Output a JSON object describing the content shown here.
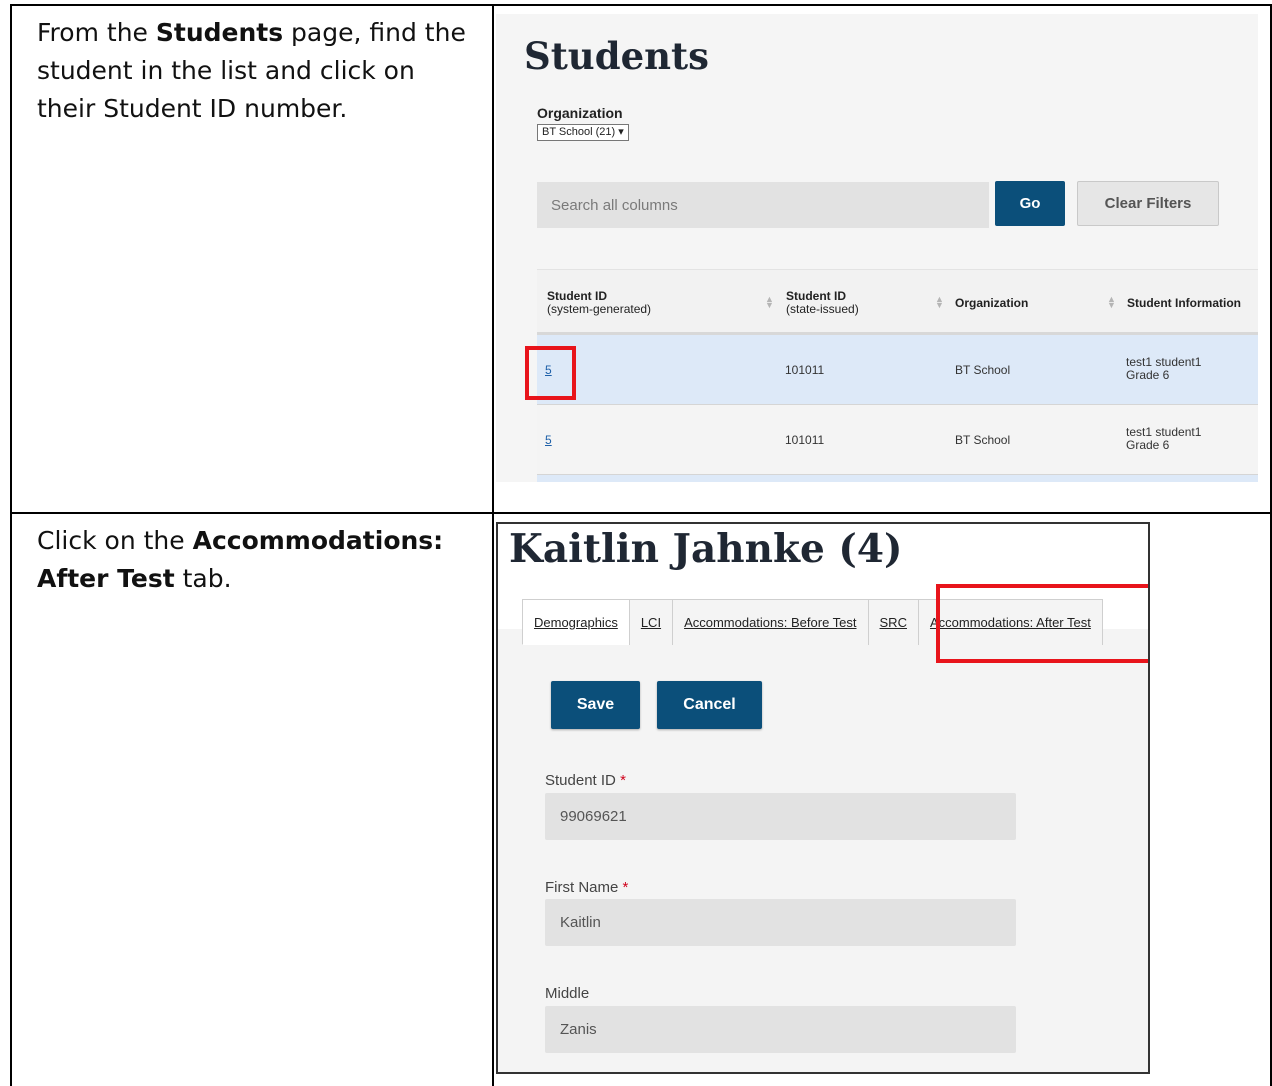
{
  "step1": {
    "instruction": {
      "before": "From the ",
      "bold": "Students",
      "after": " page, find the student in the list and click on their Student ID number."
    },
    "screen": {
      "title": "Students",
      "organization_label": "Organization",
      "organization_selected": "BT School (21) ▾",
      "search_placeholder": "Search all columns",
      "go_label": "Go",
      "clear_label": "Clear Filters",
      "columns": [
        {
          "title": "Student ID",
          "sub": "(system-generated)"
        },
        {
          "title": "Student ID",
          "sub": "(state-issued)"
        },
        {
          "title": "Organization",
          "sub": ""
        },
        {
          "title": "Student Information",
          "sub": ""
        }
      ],
      "rows": [
        {
          "id": "5",
          "state_id": "101011",
          "org": "BT School",
          "name": "test1 student1",
          "grade": "Grade 6"
        },
        {
          "id": "5",
          "state_id": "101011",
          "org": "BT School",
          "name": "test1 student1",
          "grade": "Grade 6"
        }
      ]
    }
  },
  "step2": {
    "instruction": {
      "before": "Click on the ",
      "bold": "Accommodations: After Test",
      "after": " tab."
    },
    "screen": {
      "title": "Kaitlin Jahnke (4)",
      "tabs": [
        "Demographics",
        "LCI",
        "Accommodations: Before Test",
        "SRC",
        "Accommodations: After Test"
      ],
      "save_label": "Save",
      "cancel_label": "Cancel",
      "fields": [
        {
          "label": "Student ID",
          "required": "*",
          "value": "99069621"
        },
        {
          "label": "First Name",
          "required": "*",
          "value": "Kaitlin"
        },
        {
          "label": "Middle",
          "required": "",
          "value": "Zanis"
        }
      ]
    }
  },
  "colors": {
    "primary_button": "#0b4f7a",
    "highlight_box": "#e8141b",
    "selected_row": "#dde9f8"
  }
}
